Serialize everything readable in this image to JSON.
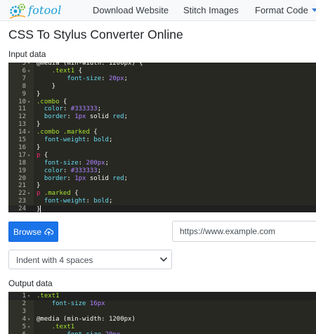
{
  "nav": {
    "logo_text": "fotool",
    "items": [
      {
        "label": "Download Website"
      },
      {
        "label": "Stitch Images"
      },
      {
        "label": "Format Code",
        "icon": "caret-down-icon"
      }
    ]
  },
  "page": {
    "title": "CSS To Stylus Converter Online",
    "input_label": "Input data",
    "output_label": "Output data"
  },
  "input_editor": {
    "lines": [
      {
        "n": "5",
        "fold": true,
        "segs": [
          [
            "plain",
            "@media (min-width: 1200px) {"
          ]
        ]
      },
      {
        "n": "6",
        "fold": true,
        "segs": [
          [
            "plain",
            "    "
          ],
          [
            "sel",
            ".text1"
          ],
          [
            "plain",
            " {"
          ]
        ]
      },
      {
        "n": "7",
        "fold": false,
        "segs": [
          [
            "plain",
            "        "
          ],
          [
            "prop",
            "font-size"
          ],
          [
            "plain",
            ": "
          ],
          [
            "num",
            "20px"
          ],
          [
            "plain",
            ";"
          ]
        ]
      },
      {
        "n": "8",
        "fold": false,
        "segs": [
          [
            "plain",
            "    }"
          ]
        ]
      },
      {
        "n": "9",
        "fold": false,
        "segs": [
          [
            "plain",
            "}"
          ]
        ]
      },
      {
        "n": "10",
        "fold": true,
        "segs": [
          [
            "sel",
            ".combo"
          ],
          [
            "plain",
            " {"
          ]
        ]
      },
      {
        "n": "11",
        "fold": false,
        "segs": [
          [
            "plain",
            "  "
          ],
          [
            "prop",
            "color"
          ],
          [
            "plain",
            ": "
          ],
          [
            "num",
            "#333333"
          ],
          [
            "plain",
            ";"
          ]
        ]
      },
      {
        "n": "12",
        "fold": false,
        "segs": [
          [
            "plain",
            "  "
          ],
          [
            "prop",
            "border"
          ],
          [
            "plain",
            ": "
          ],
          [
            "num",
            "1px"
          ],
          [
            "plain",
            " solid "
          ],
          [
            "prop",
            "red"
          ],
          [
            "plain",
            ";"
          ]
        ]
      },
      {
        "n": "13",
        "fold": false,
        "segs": [
          [
            "plain",
            "}"
          ]
        ]
      },
      {
        "n": "14",
        "fold": true,
        "segs": [
          [
            "sel",
            ".combo .marked"
          ],
          [
            "plain",
            " {"
          ]
        ]
      },
      {
        "n": "15",
        "fold": false,
        "segs": [
          [
            "plain",
            "  "
          ],
          [
            "prop",
            "font-weight"
          ],
          [
            "plain",
            ": "
          ],
          [
            "prop",
            "bold"
          ],
          [
            "plain",
            ";"
          ]
        ]
      },
      {
        "n": "16",
        "fold": false,
        "segs": [
          [
            "plain",
            "}"
          ]
        ]
      },
      {
        "n": "17",
        "fold": true,
        "segs": [
          [
            "kw",
            "p"
          ],
          [
            "plain",
            " {"
          ]
        ]
      },
      {
        "n": "18",
        "fold": false,
        "segs": [
          [
            "plain",
            "  "
          ],
          [
            "prop",
            "font-size"
          ],
          [
            "plain",
            ": "
          ],
          [
            "num",
            "200px"
          ],
          [
            "plain",
            ";"
          ]
        ]
      },
      {
        "n": "19",
        "fold": false,
        "segs": [
          [
            "plain",
            "  "
          ],
          [
            "prop",
            "color"
          ],
          [
            "plain",
            ": "
          ],
          [
            "num",
            "#333333"
          ],
          [
            "plain",
            ";"
          ]
        ]
      },
      {
        "n": "20",
        "fold": false,
        "segs": [
          [
            "plain",
            "  "
          ],
          [
            "prop",
            "border"
          ],
          [
            "plain",
            ": "
          ],
          [
            "num",
            "1px"
          ],
          [
            "plain",
            " solid "
          ],
          [
            "prop",
            "red"
          ],
          [
            "plain",
            ";"
          ]
        ]
      },
      {
        "n": "21",
        "fold": false,
        "segs": [
          [
            "plain",
            "}"
          ]
        ]
      },
      {
        "n": "22",
        "fold": true,
        "segs": [
          [
            "kw",
            "p"
          ],
          [
            "plain",
            " "
          ],
          [
            "sel",
            ".marked"
          ],
          [
            "plain",
            " {"
          ]
        ]
      },
      {
        "n": "23",
        "fold": false,
        "segs": [
          [
            "plain",
            "  "
          ],
          [
            "prop",
            "font-weight"
          ],
          [
            "plain",
            ": "
          ],
          [
            "prop",
            "bold"
          ],
          [
            "plain",
            ";"
          ]
        ]
      },
      {
        "n": "24",
        "fold": false,
        "active": true,
        "segs": [
          [
            "plain",
            "}"
          ]
        ]
      }
    ]
  },
  "controls": {
    "browse_label": "Browse",
    "browse_icon": "cloud-upload-icon",
    "url_placeholder": "https://www.example.com",
    "indent_selected": "Indent with 4 spaces"
  },
  "output_editor": {
    "lines": [
      {
        "n": "1",
        "fold": true,
        "active": true,
        "segs": [
          [
            "sel",
            ".text1"
          ]
        ]
      },
      {
        "n": "2",
        "fold": false,
        "segs": [
          [
            "plain",
            "    "
          ],
          [
            "prop",
            "font-size"
          ],
          [
            "plain",
            " "
          ],
          [
            "num",
            "16px"
          ]
        ]
      },
      {
        "n": "3",
        "fold": false,
        "segs": []
      },
      {
        "n": "4",
        "fold": true,
        "segs": [
          [
            "plain",
            "@media (min-width: 1200px)"
          ]
        ]
      },
      {
        "n": "5",
        "fold": true,
        "segs": [
          [
            "plain",
            "    "
          ],
          [
            "sel",
            ".text1"
          ]
        ]
      },
      {
        "n": "6",
        "fold": false,
        "segs": [
          [
            "plain",
            "        "
          ],
          [
            "prop",
            "font-size"
          ],
          [
            "plain",
            " "
          ],
          [
            "num",
            "20px"
          ]
        ]
      }
    ]
  },
  "colors": {
    "brand": "#1e9fd6",
    "button": "#1a73e8",
    "editor_bg": "#272822"
  }
}
